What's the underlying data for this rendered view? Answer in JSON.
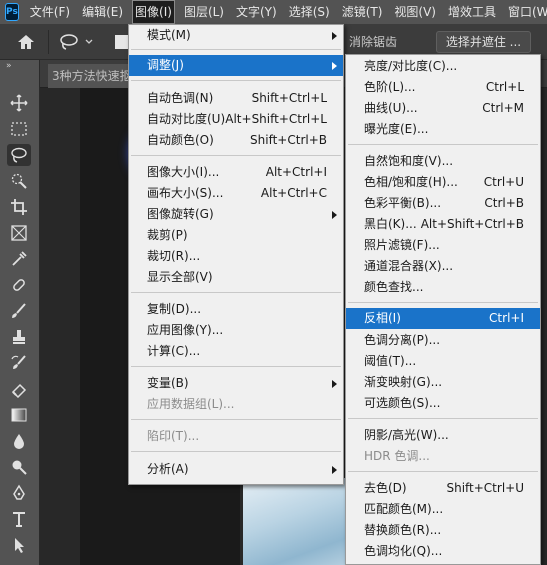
{
  "menubar": {
    "items": [
      "文件(F)",
      "编辑(E)",
      "图像(I)",
      "图层(L)",
      "文字(Y)",
      "选择(S)",
      "滤镜(T)",
      "视图(V)",
      "增效工具",
      "窗口(W)"
    ]
  },
  "options": {
    "antialias_label": "消除锯齿",
    "select_mask_label": "选择并遮住 ..."
  },
  "tab": {
    "title": "3种方法快速抠"
  },
  "image_menu": {
    "items": [
      {
        "label": "模式(M)",
        "shortcut": ""
      },
      {
        "label": "调整(J)",
        "shortcut": ""
      },
      {
        "label": "自动色调(N)",
        "shortcut": "Shift+Ctrl+L"
      },
      {
        "label": "自动对比度(U)",
        "shortcut": "Alt+Shift+Ctrl+L"
      },
      {
        "label": "自动颜色(O)",
        "shortcut": "Shift+Ctrl+B"
      },
      {
        "label": "图像大小(I)...",
        "shortcut": "Alt+Ctrl+I"
      },
      {
        "label": "画布大小(S)...",
        "shortcut": "Alt+Ctrl+C"
      },
      {
        "label": "图像旋转(G)",
        "shortcut": ""
      },
      {
        "label": "裁剪(P)",
        "shortcut": ""
      },
      {
        "label": "裁切(R)...",
        "shortcut": ""
      },
      {
        "label": "显示全部(V)",
        "shortcut": ""
      },
      {
        "label": "复制(D)...",
        "shortcut": ""
      },
      {
        "label": "应用图像(Y)...",
        "shortcut": ""
      },
      {
        "label": "计算(C)...",
        "shortcut": ""
      },
      {
        "label": "变量(B)",
        "shortcut": ""
      },
      {
        "label": "应用数据组(L)...",
        "shortcut": ""
      },
      {
        "label": "陷印(T)...",
        "shortcut": ""
      },
      {
        "label": "分析(A)",
        "shortcut": ""
      }
    ]
  },
  "adjust_menu": {
    "items": [
      {
        "label": "亮度/对比度(C)...",
        "shortcut": ""
      },
      {
        "label": "色阶(L)...",
        "shortcut": "Ctrl+L"
      },
      {
        "label": "曲线(U)...",
        "shortcut": "Ctrl+M"
      },
      {
        "label": "曝光度(E)...",
        "shortcut": ""
      },
      {
        "label": "自然饱和度(V)...",
        "shortcut": ""
      },
      {
        "label": "色相/饱和度(H)...",
        "shortcut": "Ctrl+U"
      },
      {
        "label": "色彩平衡(B)...",
        "shortcut": "Ctrl+B"
      },
      {
        "label": "黑白(K)...",
        "shortcut": "Alt+Shift+Ctrl+B"
      },
      {
        "label": "照片滤镜(F)...",
        "shortcut": ""
      },
      {
        "label": "通道混合器(X)...",
        "shortcut": ""
      },
      {
        "label": "颜色查找...",
        "shortcut": ""
      },
      {
        "label": "反相(I)",
        "shortcut": "Ctrl+I"
      },
      {
        "label": "色调分离(P)...",
        "shortcut": ""
      },
      {
        "label": "阈值(T)...",
        "shortcut": ""
      },
      {
        "label": "渐变映射(G)...",
        "shortcut": ""
      },
      {
        "label": "可选颜色(S)...",
        "shortcut": ""
      },
      {
        "label": "阴影/高光(W)...",
        "shortcut": ""
      },
      {
        "label": "HDR 色调...",
        "shortcut": ""
      },
      {
        "label": "去色(D)",
        "shortcut": "Shift+Ctrl+U"
      },
      {
        "label": "匹配颜色(M)...",
        "shortcut": ""
      },
      {
        "label": "替换颜色(R)...",
        "shortcut": ""
      },
      {
        "label": "色调均化(Q)...",
        "shortcut": ""
      }
    ]
  },
  "colors": {
    "highlight": "#1a73c9",
    "menubar": "#535353",
    "menu_bg": "#f0f0f0"
  }
}
